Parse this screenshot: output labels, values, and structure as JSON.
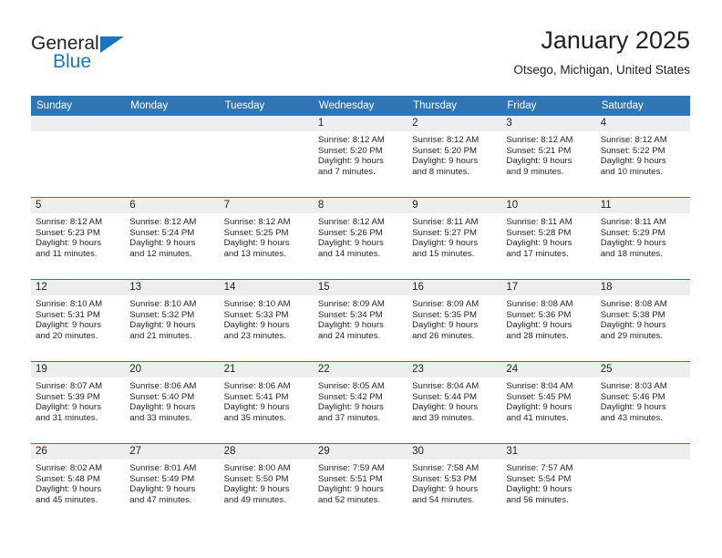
{
  "brand": {
    "name_top": "General",
    "name_bottom": "Blue",
    "accent_color": "#1b75bb"
  },
  "header": {
    "title": "January 2025",
    "subtitle": "Otsego, Michigan, United States",
    "header_bg": "#3075b4",
    "daynum_bg": "#eeeeee"
  },
  "weekday_headers": [
    "Sunday",
    "Monday",
    "Tuesday",
    "Wednesday",
    "Thursday",
    "Friday",
    "Saturday"
  ],
  "weeks": [
    [
      {
        "day": "",
        "sunrise": "",
        "sunset": "",
        "daylight1": "",
        "daylight2": ""
      },
      {
        "day": "",
        "sunrise": "",
        "sunset": "",
        "daylight1": "",
        "daylight2": ""
      },
      {
        "day": "",
        "sunrise": "",
        "sunset": "",
        "daylight1": "",
        "daylight2": ""
      },
      {
        "day": "1",
        "sunrise": "Sunrise: 8:12 AM",
        "sunset": "Sunset: 5:20 PM",
        "daylight1": "Daylight: 9 hours",
        "daylight2": "and 7 minutes."
      },
      {
        "day": "2",
        "sunrise": "Sunrise: 8:12 AM",
        "sunset": "Sunset: 5:20 PM",
        "daylight1": "Daylight: 9 hours",
        "daylight2": "and 8 minutes."
      },
      {
        "day": "3",
        "sunrise": "Sunrise: 8:12 AM",
        "sunset": "Sunset: 5:21 PM",
        "daylight1": "Daylight: 9 hours",
        "daylight2": "and 9 minutes."
      },
      {
        "day": "4",
        "sunrise": "Sunrise: 8:12 AM",
        "sunset": "Sunset: 5:22 PM",
        "daylight1": "Daylight: 9 hours",
        "daylight2": "and 10 minutes."
      }
    ],
    [
      {
        "day": "5",
        "sunrise": "Sunrise: 8:12 AM",
        "sunset": "Sunset: 5:23 PM",
        "daylight1": "Daylight: 9 hours",
        "daylight2": "and 11 minutes."
      },
      {
        "day": "6",
        "sunrise": "Sunrise: 8:12 AM",
        "sunset": "Sunset: 5:24 PM",
        "daylight1": "Daylight: 9 hours",
        "daylight2": "and 12 minutes."
      },
      {
        "day": "7",
        "sunrise": "Sunrise: 8:12 AM",
        "sunset": "Sunset: 5:25 PM",
        "daylight1": "Daylight: 9 hours",
        "daylight2": "and 13 minutes."
      },
      {
        "day": "8",
        "sunrise": "Sunrise: 8:12 AM",
        "sunset": "Sunset: 5:26 PM",
        "daylight1": "Daylight: 9 hours",
        "daylight2": "and 14 minutes."
      },
      {
        "day": "9",
        "sunrise": "Sunrise: 8:11 AM",
        "sunset": "Sunset: 5:27 PM",
        "daylight1": "Daylight: 9 hours",
        "daylight2": "and 15 minutes."
      },
      {
        "day": "10",
        "sunrise": "Sunrise: 8:11 AM",
        "sunset": "Sunset: 5:28 PM",
        "daylight1": "Daylight: 9 hours",
        "daylight2": "and 17 minutes."
      },
      {
        "day": "11",
        "sunrise": "Sunrise: 8:11 AM",
        "sunset": "Sunset: 5:29 PM",
        "daylight1": "Daylight: 9 hours",
        "daylight2": "and 18 minutes."
      }
    ],
    [
      {
        "day": "12",
        "sunrise": "Sunrise: 8:10 AM",
        "sunset": "Sunset: 5:31 PM",
        "daylight1": "Daylight: 9 hours",
        "daylight2": "and 20 minutes."
      },
      {
        "day": "13",
        "sunrise": "Sunrise: 8:10 AM",
        "sunset": "Sunset: 5:32 PM",
        "daylight1": "Daylight: 9 hours",
        "daylight2": "and 21 minutes."
      },
      {
        "day": "14",
        "sunrise": "Sunrise: 8:10 AM",
        "sunset": "Sunset: 5:33 PM",
        "daylight1": "Daylight: 9 hours",
        "daylight2": "and 23 minutes."
      },
      {
        "day": "15",
        "sunrise": "Sunrise: 8:09 AM",
        "sunset": "Sunset: 5:34 PM",
        "daylight1": "Daylight: 9 hours",
        "daylight2": "and 24 minutes."
      },
      {
        "day": "16",
        "sunrise": "Sunrise: 8:09 AM",
        "sunset": "Sunset: 5:35 PM",
        "daylight1": "Daylight: 9 hours",
        "daylight2": "and 26 minutes."
      },
      {
        "day": "17",
        "sunrise": "Sunrise: 8:08 AM",
        "sunset": "Sunset: 5:36 PM",
        "daylight1": "Daylight: 9 hours",
        "daylight2": "and 28 minutes."
      },
      {
        "day": "18",
        "sunrise": "Sunrise: 8:08 AM",
        "sunset": "Sunset: 5:38 PM",
        "daylight1": "Daylight: 9 hours",
        "daylight2": "and 29 minutes."
      }
    ],
    [
      {
        "day": "19",
        "sunrise": "Sunrise: 8:07 AM",
        "sunset": "Sunset: 5:39 PM",
        "daylight1": "Daylight: 9 hours",
        "daylight2": "and 31 minutes."
      },
      {
        "day": "20",
        "sunrise": "Sunrise: 8:06 AM",
        "sunset": "Sunset: 5:40 PM",
        "daylight1": "Daylight: 9 hours",
        "daylight2": "and 33 minutes."
      },
      {
        "day": "21",
        "sunrise": "Sunrise: 8:06 AM",
        "sunset": "Sunset: 5:41 PM",
        "daylight1": "Daylight: 9 hours",
        "daylight2": "and 35 minutes."
      },
      {
        "day": "22",
        "sunrise": "Sunrise: 8:05 AM",
        "sunset": "Sunset: 5:42 PM",
        "daylight1": "Daylight: 9 hours",
        "daylight2": "and 37 minutes."
      },
      {
        "day": "23",
        "sunrise": "Sunrise: 8:04 AM",
        "sunset": "Sunset: 5:44 PM",
        "daylight1": "Daylight: 9 hours",
        "daylight2": "and 39 minutes."
      },
      {
        "day": "24",
        "sunrise": "Sunrise: 8:04 AM",
        "sunset": "Sunset: 5:45 PM",
        "daylight1": "Daylight: 9 hours",
        "daylight2": "and 41 minutes."
      },
      {
        "day": "25",
        "sunrise": "Sunrise: 8:03 AM",
        "sunset": "Sunset: 5:46 PM",
        "daylight1": "Daylight: 9 hours",
        "daylight2": "and 43 minutes."
      }
    ],
    [
      {
        "day": "26",
        "sunrise": "Sunrise: 8:02 AM",
        "sunset": "Sunset: 5:48 PM",
        "daylight1": "Daylight: 9 hours",
        "daylight2": "and 45 minutes."
      },
      {
        "day": "27",
        "sunrise": "Sunrise: 8:01 AM",
        "sunset": "Sunset: 5:49 PM",
        "daylight1": "Daylight: 9 hours",
        "daylight2": "and 47 minutes."
      },
      {
        "day": "28",
        "sunrise": "Sunrise: 8:00 AM",
        "sunset": "Sunset: 5:50 PM",
        "daylight1": "Daylight: 9 hours",
        "daylight2": "and 49 minutes."
      },
      {
        "day": "29",
        "sunrise": "Sunrise: 7:59 AM",
        "sunset": "Sunset: 5:51 PM",
        "daylight1": "Daylight: 9 hours",
        "daylight2": "and 52 minutes."
      },
      {
        "day": "30",
        "sunrise": "Sunrise: 7:58 AM",
        "sunset": "Sunset: 5:53 PM",
        "daylight1": "Daylight: 9 hours",
        "daylight2": "and 54 minutes."
      },
      {
        "day": "31",
        "sunrise": "Sunrise: 7:57 AM",
        "sunset": "Sunset: 5:54 PM",
        "daylight1": "Daylight: 9 hours",
        "daylight2": "and 56 minutes."
      },
      {
        "day": "",
        "sunrise": "",
        "sunset": "",
        "daylight1": "",
        "daylight2": ""
      }
    ]
  ]
}
